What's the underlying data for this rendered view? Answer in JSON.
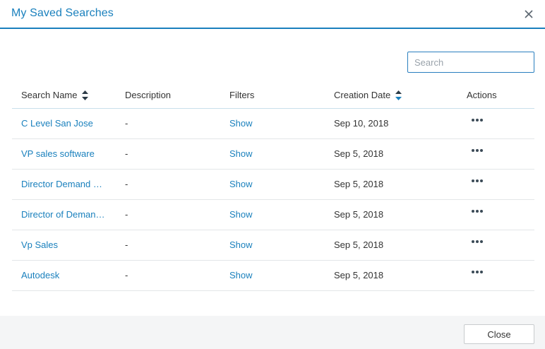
{
  "dialog": {
    "title": "My Saved Searches",
    "close_icon": "close-icon"
  },
  "search": {
    "placeholder": "Search",
    "value": ""
  },
  "table": {
    "columns": [
      "Search Name",
      "Description",
      "Filters",
      "Creation Date",
      "Actions"
    ],
    "sort": {
      "search_name": "unsorted",
      "creation_date": "descending"
    },
    "rows": [
      {
        "name": "C Level San Jose",
        "description": "-",
        "filters": "Show",
        "date": "Sep 10, 2018",
        "actions": "more-icon"
      },
      {
        "name": "VP sales software",
        "description": "-",
        "filters": "Show",
        "date": "Sep 5, 2018",
        "actions": "more-icon"
      },
      {
        "name": "Director Demand G…",
        "description": "-",
        "filters": "Show",
        "date": "Sep 5, 2018",
        "actions": "more-icon"
      },
      {
        "name": "Director of Demand…",
        "description": "-",
        "filters": "Show",
        "date": "Sep 5, 2018",
        "actions": "more-icon"
      },
      {
        "name": "Vp Sales",
        "description": "-",
        "filters": "Show",
        "date": "Sep 5, 2018",
        "actions": "more-icon"
      },
      {
        "name": "Autodesk",
        "description": "-",
        "filters": "Show",
        "date": "Sep 5, 2018",
        "actions": "more-icon"
      }
    ]
  },
  "footer": {
    "close_label": "Close"
  },
  "colors": {
    "accent": "#1a80bd",
    "footer_bg": "#f4f5f6",
    "header_rule": "#1a80bd"
  }
}
